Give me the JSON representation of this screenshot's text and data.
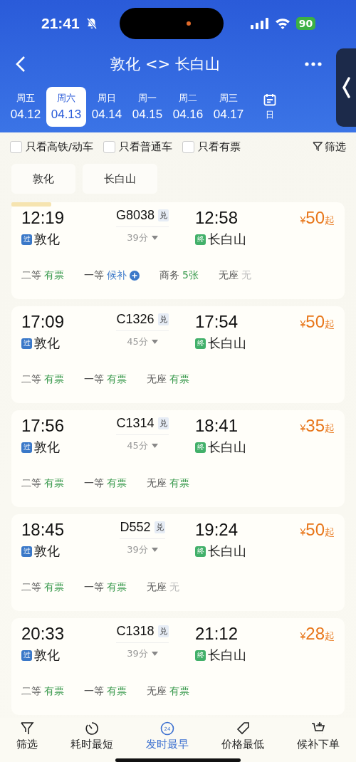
{
  "status_bar": {
    "time": "21:41",
    "battery": "90"
  },
  "nav": {
    "title": "敦化 <> 长白山"
  },
  "dates": [
    {
      "weekday": "周五",
      "date": "04.12",
      "selected": false
    },
    {
      "weekday": "周六",
      "date": "04.13",
      "selected": true
    },
    {
      "weekday": "周日",
      "date": "04.14",
      "selected": false
    },
    {
      "weekday": "周一",
      "date": "04.15",
      "selected": false
    },
    {
      "weekday": "周二",
      "date": "04.16",
      "selected": false
    },
    {
      "weekday": "周三",
      "date": "04.17",
      "selected": false
    }
  ],
  "calendar": {
    "label": "日"
  },
  "filters": [
    {
      "label": "只看高铁/动车",
      "checked": false
    },
    {
      "label": "只看普通车",
      "checked": false
    },
    {
      "label": "只看有票",
      "checked": false
    }
  ],
  "filter_button": "筛选",
  "stations": [
    "敦化",
    "长白山"
  ],
  "trains": [
    {
      "depart": "12:19",
      "train": "G8038",
      "exchange": "兑",
      "duration": "39分",
      "arrive": "12:58",
      "from_badge": "过",
      "from": "敦化",
      "to_badge": "终",
      "to": "长白山",
      "price_symbol": "¥",
      "price": "50",
      "price_suffix": "起",
      "tag": true,
      "seats": [
        {
          "class": "二等",
          "status": "有票",
          "kind": "available"
        },
        {
          "class": "一等",
          "status": "候补",
          "kind": "waitlist"
        },
        {
          "class": "商务",
          "status": "5张",
          "kind": "available"
        },
        {
          "class": "无座",
          "status": "无",
          "kind": "none"
        }
      ]
    },
    {
      "depart": "17:09",
      "train": "C1326",
      "exchange": "兑",
      "duration": "45分",
      "arrive": "17:54",
      "from_badge": "过",
      "from": "敦化",
      "to_badge": "终",
      "to": "长白山",
      "price_symbol": "¥",
      "price": "50",
      "price_suffix": "起",
      "tag": false,
      "seats": [
        {
          "class": "二等",
          "status": "有票",
          "kind": "available"
        },
        {
          "class": "一等",
          "status": "有票",
          "kind": "available"
        },
        {
          "class": "无座",
          "status": "有票",
          "kind": "available"
        }
      ]
    },
    {
      "depart": "17:56",
      "train": "C1314",
      "exchange": "兑",
      "duration": "45分",
      "arrive": "18:41",
      "from_badge": "过",
      "from": "敦化",
      "to_badge": "终",
      "to": "长白山",
      "price_symbol": "¥",
      "price": "35",
      "price_suffix": "起",
      "tag": false,
      "seats": [
        {
          "class": "二等",
          "status": "有票",
          "kind": "available"
        },
        {
          "class": "一等",
          "status": "有票",
          "kind": "available"
        },
        {
          "class": "无座",
          "status": "有票",
          "kind": "available"
        }
      ]
    },
    {
      "depart": "18:45",
      "train": "D552",
      "exchange": "兑",
      "duration": "39分",
      "arrive": "19:24",
      "from_badge": "过",
      "from": "敦化",
      "to_badge": "终",
      "to": "长白山",
      "price_symbol": "¥",
      "price": "50",
      "price_suffix": "起",
      "tag": false,
      "seats": [
        {
          "class": "二等",
          "status": "有票",
          "kind": "available"
        },
        {
          "class": "一等",
          "status": "有票",
          "kind": "available"
        },
        {
          "class": "无座",
          "status": "无",
          "kind": "none"
        }
      ]
    },
    {
      "depart": "20:33",
      "train": "C1318",
      "exchange": "兑",
      "duration": "39分",
      "arrive": "21:12",
      "from_badge": "过",
      "from": "敦化",
      "to_badge": "终",
      "to": "长白山",
      "price_symbol": "¥",
      "price": "28",
      "price_suffix": "起",
      "tag": false,
      "seats": [
        {
          "class": "二等",
          "status": "有票",
          "kind": "available"
        },
        {
          "class": "一等",
          "status": "有票",
          "kind": "available"
        },
        {
          "class": "无座",
          "status": "有票",
          "kind": "available"
        }
      ]
    }
  ],
  "bottom_tabs": [
    {
      "label": "筛选",
      "selected": false
    },
    {
      "label": "耗时最短",
      "selected": false
    },
    {
      "label": "发时最早",
      "icon_text": "24",
      "selected": true
    },
    {
      "label": "价格最低",
      "selected": false
    },
    {
      "label": "候补下单",
      "selected": false
    }
  ]
}
